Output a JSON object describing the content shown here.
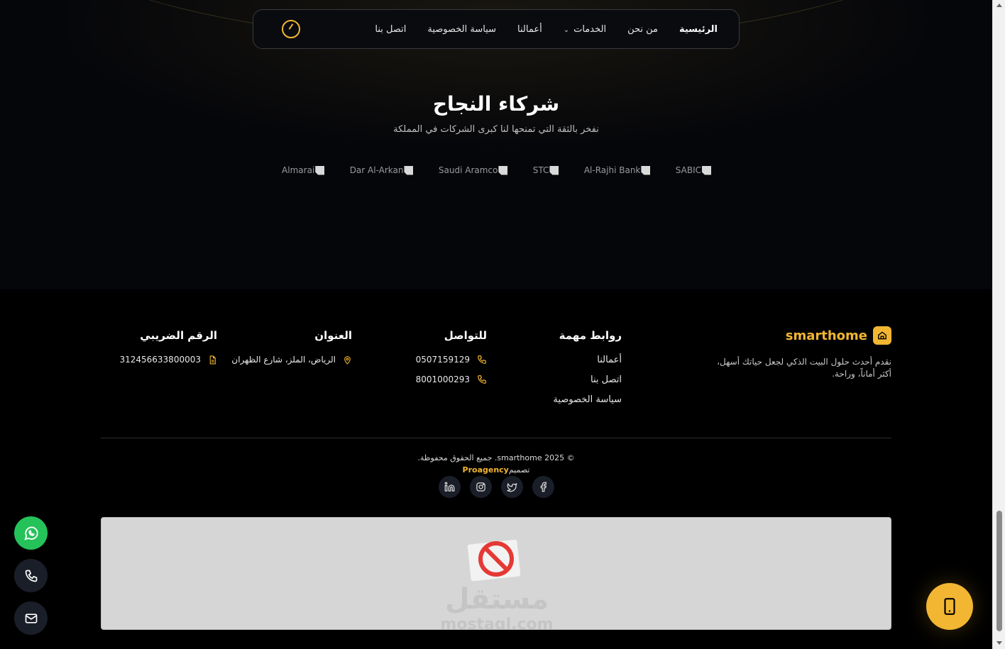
{
  "nav": {
    "items": [
      {
        "label": "الرئيسية",
        "active": true
      },
      {
        "label": "من نحن"
      },
      {
        "label": "الخدمات",
        "dropdown": true
      },
      {
        "label": "أعمالنا"
      },
      {
        "label": "سياسة الخصوصية"
      },
      {
        "label": "اتصل بنا"
      }
    ]
  },
  "partners": {
    "title": "شركاء النجاح",
    "subtitle": "نفخر بالثقة التي تمنحها لنا كبرى الشركات في المملكة",
    "logos": [
      "SABIC",
      "Al-Rajhi Bank",
      "STC",
      "Saudi Aramco",
      "Dar Al-Arkan",
      "Almarai"
    ]
  },
  "footer": {
    "brand_name": "smarthome",
    "brand_desc": "نقدم أحدث حلول البيت الذكي لجعل حياتك أسهل، أكثر أماناً، وراحة.",
    "links": {
      "title": "روابط مهمة",
      "items": [
        "أعمالنا",
        "اتصل بنا",
        "سياسة الخصوصية"
      ]
    },
    "contact": {
      "title": "للتواصل",
      "phones": [
        "0507159129",
        "8001000293"
      ]
    },
    "address": {
      "title": "العنوان",
      "value": "الرياض، الملز، شارع الظهران"
    },
    "tax": {
      "title": "الرقم الضريبي",
      "value": "312456633800003"
    },
    "copyright": "© smarthome 2025. جميع الحقوق محفوظة.",
    "designer_prefix": "تصميم",
    "designer_name": "Proagency",
    "socials": [
      "linkedin-icon",
      "instagram-icon",
      "twitter-icon",
      "facebook-icon"
    ]
  },
  "embed": {
    "watermark": "مستقل",
    "watermark_url": "mostaql.com"
  },
  "colors": {
    "accent": "#f2b632",
    "whatsapp": "#25c25a",
    "background": "#000000"
  }
}
